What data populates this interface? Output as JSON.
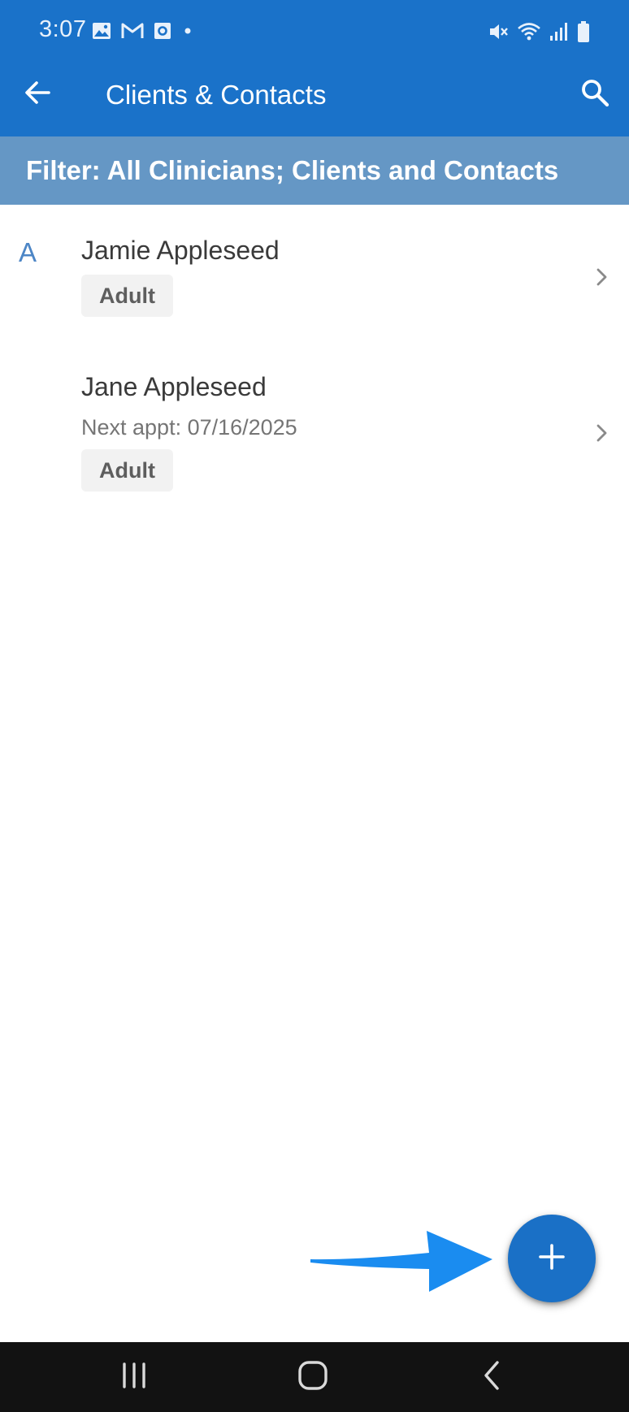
{
  "status_bar": {
    "time": "3:07",
    "left_icons": [
      "gallery-icon",
      "gmail-icon",
      "outlook-icon",
      "dot-icon"
    ],
    "right_icons": [
      "mute-icon",
      "wifi-icon",
      "signal-icon",
      "battery-icon"
    ]
  },
  "app_bar": {
    "title": "Clients & Contacts",
    "back_icon": "arrow-left-icon",
    "search_icon": "search-icon",
    "color": "#1a72c9"
  },
  "filter_bar": {
    "text": "Filter: All Clinicians; Clients and Contacts",
    "color": "#6597c5"
  },
  "list": {
    "section_letter": "A",
    "items": [
      {
        "name": "Jamie Appleseed",
        "next_appt": "",
        "badge": "Adult"
      },
      {
        "name": "Jane Appleseed",
        "next_appt": "Next appt: 07/16/2025",
        "badge": "Adult"
      }
    ]
  },
  "fab": {
    "icon": "plus-icon",
    "color": "#1a70c6"
  },
  "annotation": {
    "icon": "arrow-right-icon",
    "color": "#1a8cf0"
  },
  "nav_bar": {
    "icons": [
      "recent-apps-icon",
      "home-icon",
      "back-icon"
    ]
  }
}
